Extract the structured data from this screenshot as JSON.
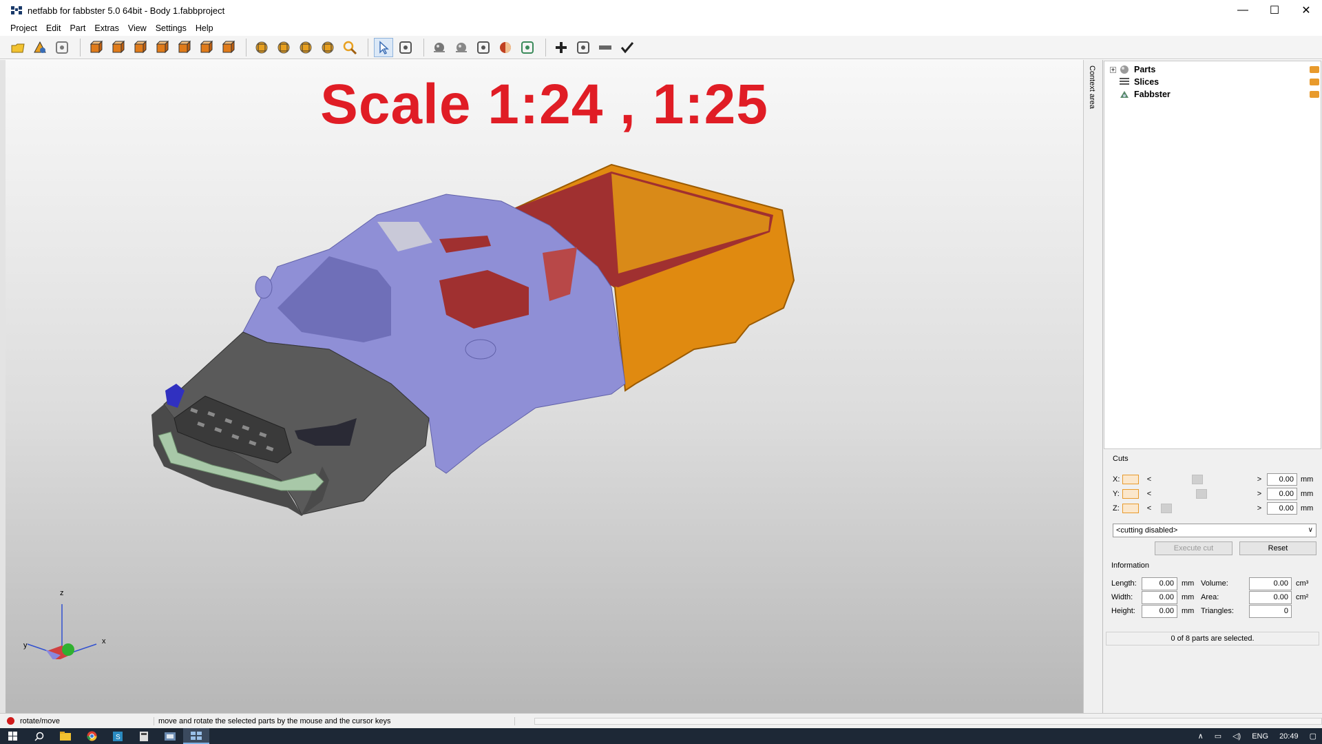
{
  "window": {
    "title": "netfabb for fabbster 5.0 64bit - Body 1.fabbproject",
    "controls": [
      "—",
      "☐",
      "✕"
    ]
  },
  "menu": [
    "Project",
    "Edit",
    "Part",
    "Extras",
    "View",
    "Settings",
    "Help"
  ],
  "toolbar": {
    "items": [
      {
        "name": "open-project-icon",
        "color": "#f2c230"
      },
      {
        "name": "add-part-icon",
        "color": "#e8a020"
      },
      {
        "name": "settings-doc-icon",
        "color": "#7a7a7a"
      },
      {
        "name": "view-front-icon",
        "color": "#e07b1a"
      },
      {
        "name": "view-back-icon",
        "color": "#e07b1a"
      },
      {
        "name": "view-left-icon",
        "color": "#e07b1a"
      },
      {
        "name": "view-right-icon",
        "color": "#e07b1a"
      },
      {
        "name": "view-top-icon",
        "color": "#e07b1a"
      },
      {
        "name": "view-bottom-icon",
        "color": "#e07b1a"
      },
      {
        "name": "view-iso-icon",
        "color": "#e07b1a"
      },
      {
        "name": "zoom-all-icon",
        "color": "#e8a020"
      },
      {
        "name": "zoom-selection-icon",
        "color": "#e8a020"
      },
      {
        "name": "zoom-fit-icon",
        "color": "#e8a020"
      },
      {
        "name": "zoom-window-icon",
        "color": "#e8a020"
      },
      {
        "name": "magnifier-icon",
        "color": "#e8a020"
      },
      {
        "name": "select-cursor-icon",
        "color": "#3a6db5"
      },
      {
        "name": "measure-axis-icon",
        "color": "#555555"
      },
      {
        "name": "sphere-icon",
        "color": "#777777"
      },
      {
        "name": "sphere-light-icon",
        "color": "#888888"
      },
      {
        "name": "axis-transform-icon",
        "color": "#555555"
      },
      {
        "name": "shading-icon",
        "color": "#c04020"
      },
      {
        "name": "camera-icon",
        "color": "#3a8a5a"
      },
      {
        "name": "add-icon",
        "color": "#222222"
      },
      {
        "name": "repair-icon",
        "color": "#555555"
      },
      {
        "name": "ruler-icon",
        "color": "#666666"
      },
      {
        "name": "checkmark-icon",
        "color": "#222222"
      }
    ]
  },
  "viewport": {
    "headline": "Scale 1:24 , 1:25",
    "axis_labels": {
      "x": "x",
      "y": "y",
      "z": "z"
    }
  },
  "context_tab": "Context area",
  "tree": [
    {
      "label": "Parts",
      "expandable": true,
      "icon": "parts-icon"
    },
    {
      "label": "Slices",
      "expandable": false,
      "icon": "slices-icon"
    },
    {
      "label": "Fabbster",
      "expandable": false,
      "icon": "fabbster-icon"
    }
  ],
  "cuts": {
    "title": "Cuts",
    "rows": [
      {
        "axis": "X:",
        "value": "0.00",
        "unit": "mm",
        "position": 0.42
      },
      {
        "axis": "Y:",
        "value": "0.00",
        "unit": "mm",
        "position": 0.47
      },
      {
        "axis": "Z:",
        "value": "0.00",
        "unit": "mm",
        "position": 0.08
      }
    ],
    "mode": "<cutting disabled>",
    "execute_label": "Execute cut",
    "reset_label": "Reset"
  },
  "information": {
    "title": "Information",
    "left": [
      {
        "label": "Length:",
        "value": "0.00",
        "unit": "mm"
      },
      {
        "label": "Width:",
        "value": "0.00",
        "unit": "mm"
      },
      {
        "label": "Height:",
        "value": "0.00",
        "unit": "mm"
      }
    ],
    "right": [
      {
        "label": "Volume:",
        "value": "0.00",
        "unit": "cm³"
      },
      {
        "label": "Area:",
        "value": "0.00",
        "unit": "cm²"
      },
      {
        "label": "Triangles:",
        "value": "0",
        "unit": ""
      }
    ],
    "selection_status": "0 of 8 parts are selected."
  },
  "status": {
    "mode": "rotate/move",
    "hint": "move and rotate the selected parts by the mouse and the cursor keys"
  },
  "taskbar": {
    "tray": [
      "ENG",
      "20:49"
    ]
  },
  "model_colors": {
    "cab": "#8f8fd6",
    "hood": "#5a5a5a",
    "bed": "#e08a10",
    "bed_inner": "#a03030",
    "grille_trim": "#a8c8a8",
    "light": "#3030c0"
  }
}
